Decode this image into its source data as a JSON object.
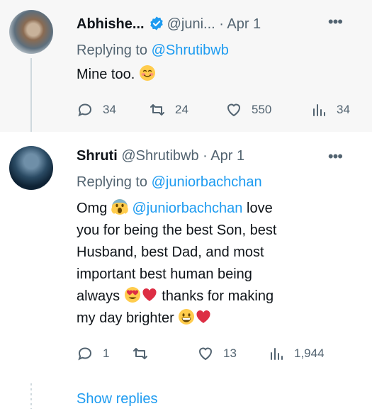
{
  "tweets": [
    {
      "name": "Abhishe...",
      "handle": "@juni...",
      "dot": "·",
      "date": "Apr 1",
      "more": "•••",
      "replying_label": "Replying to",
      "replying_to": "@Shrutibwb",
      "text": "Mine too.",
      "stats": {
        "replies": "34",
        "retweets": "24",
        "likes": "550",
        "views": "34"
      }
    },
    {
      "name": "Shruti",
      "handle": "@Shrutibwb",
      "dot": "·",
      "date": "Apr 1",
      "more": "•••",
      "replying_label": "Replying to",
      "replying_to": "@juniorbachchan",
      "text_lines": {
        "l1_a": "Omg",
        "l1_mention": "@juniorbachchan",
        "l1_b": "love",
        "l2": "you for being the best Son, best",
        "l3": "Husband, best Dad, and most",
        "l4": "important best human being",
        "l5_a": "always",
        "l5_b": "thanks for making",
        "l6": "my day brighter"
      },
      "stats": {
        "replies": "1",
        "retweets": "",
        "likes": "13",
        "views": "1,944"
      }
    }
  ],
  "show_replies": "Show replies",
  "colors": {
    "accent": "#1d9bf0",
    "muted": "#536471",
    "text": "#0f1419"
  }
}
